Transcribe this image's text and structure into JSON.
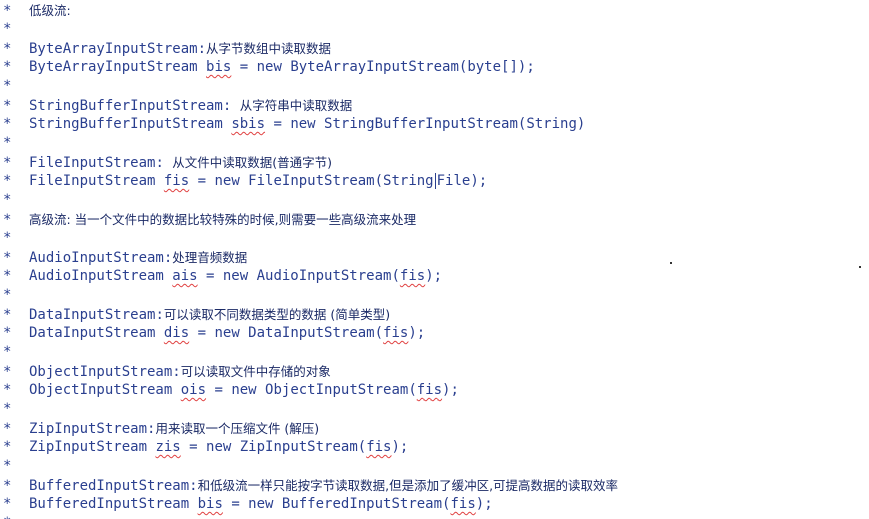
{
  "editor": {
    "comment_mark": "*",
    "lines": [
      {
        "type": "heading",
        "text": "低级流:"
      },
      {
        "type": "blank"
      },
      {
        "type": "desc",
        "cls": "ByteArrayInputStream",
        "sep": ":",
        "note": "从字节数组中读取数据"
      },
      {
        "type": "code",
        "cls": "ByteArrayInputStream",
        "var": "bis",
        "rhs": " = new ByteArrayInputStream(byte[]);"
      },
      {
        "type": "blank"
      },
      {
        "type": "desc",
        "cls": "StringBufferInputStream",
        "sep": ": ",
        "note": "从字符串中读取数据"
      },
      {
        "type": "code",
        "cls": "StringBufferInputStream",
        "var": "sbis",
        "rhs": " = new StringBufferInputStream(String)"
      },
      {
        "type": "blank"
      },
      {
        "type": "desc",
        "cls": "FileInputStream",
        "sep": ": ",
        "note": "从文件中读取数据(普通字节)"
      },
      {
        "type": "code_bar",
        "cls": "FileInputStream",
        "var": "fis",
        "rhs_a": " = new FileInputStream(String",
        "rhs_b": "File);"
      },
      {
        "type": "blank"
      },
      {
        "type": "heading",
        "text": "高级流: 当一个文件中的数据比较特殊的时候,则需要一些高级流来处理"
      },
      {
        "type": "blank"
      },
      {
        "type": "desc",
        "cls": "AudioInputStream",
        "sep": ":",
        "note": "处理音频数据"
      },
      {
        "type": "code_arg",
        "cls": "AudioInputStream",
        "var": "ais",
        "rhs": " = new AudioInputStream(",
        "arg": "fis",
        "end": ");"
      },
      {
        "type": "blank"
      },
      {
        "type": "desc",
        "cls": "DataInputStream",
        "sep": ":",
        "note": "可以读取不同数据类型的数据 (简单类型)"
      },
      {
        "type": "code_arg",
        "cls": "DataInputStream",
        "var": "dis",
        "rhs": " = new DataInputStream(",
        "arg": "fis",
        "end": ");"
      },
      {
        "type": "blank"
      },
      {
        "type": "desc",
        "cls": "ObjectInputStream",
        "sep": ":",
        "note": "可以读取文件中存储的对象"
      },
      {
        "type": "code_arg",
        "cls": "ObjectInputStream",
        "var": "ois",
        "rhs": " = new ObjectInputStream(",
        "arg": "fis",
        "end": ");"
      },
      {
        "type": "blank"
      },
      {
        "type": "desc",
        "cls": "ZipInputStream",
        "sep": ":",
        "note": "用来读取一个压缩文件 (解压)"
      },
      {
        "type": "code_arg",
        "cls": "ZipInputStream",
        "var": "zis",
        "rhs": " = new ZipInputStream(",
        "arg": "fis",
        "end": ");"
      },
      {
        "type": "blank"
      },
      {
        "type": "desc",
        "cls": "BufferedInputStream",
        "sep": ":",
        "note": "和低级流一样只能按字节读取数据,但是添加了缓冲区,可提高数据的读取效率"
      },
      {
        "type": "code_arg",
        "cls": "BufferedInputStream",
        "var": "bis",
        "rhs": " = new BufferedInputStream(",
        "arg": "fis",
        "end": ");"
      },
      {
        "type": "blank"
      }
    ]
  }
}
